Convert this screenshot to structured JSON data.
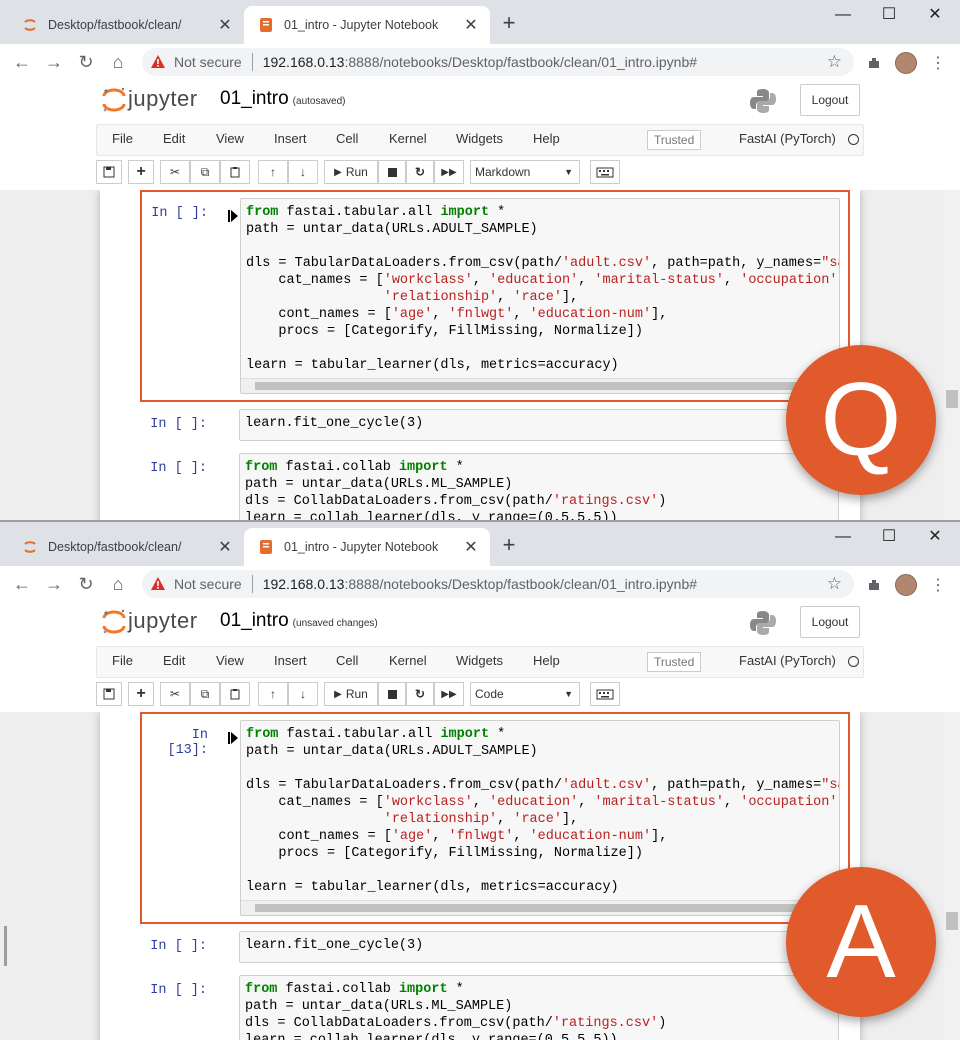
{
  "panels": [
    {
      "tabs": [
        {
          "title": "Desktop/fastbook/clean/"
        },
        {
          "title": "01_intro - Jupyter Notebook"
        }
      ],
      "address": {
        "security": "Not secure",
        "host": "192.168.0.13",
        "rest": ":8888/notebooks/Desktop/fastbook/clean/01_intro.ipynb#"
      },
      "jupyter": {
        "brand": "jupyter",
        "notebook_name": "01_intro",
        "save_status": "(autosaved)",
        "logout": "Logout"
      },
      "menu": [
        "File",
        "Edit",
        "View",
        "Insert",
        "Cell",
        "Kernel",
        "Widgets",
        "Help"
      ],
      "trusted": "Trusted",
      "kernel": "FastAI (PyTorch)",
      "toolbar": {
        "run_label": "Run",
        "cell_type": "Markdown"
      },
      "cells": [
        {
          "prompt": "In [ ]:"
        },
        {
          "prompt": "In [ ]:",
          "code": "learn.fit_one_cycle(3)"
        },
        {
          "prompt": "In [ ]:"
        }
      ],
      "badge": "Q"
    },
    {
      "tabs": [
        {
          "title": "Desktop/fastbook/clean/"
        },
        {
          "title": "01_intro - Jupyter Notebook"
        }
      ],
      "address": {
        "security": "Not secure",
        "host": "192.168.0.13",
        "rest": ":8888/notebooks/Desktop/fastbook/clean/01_intro.ipynb#"
      },
      "jupyter": {
        "brand": "jupyter",
        "notebook_name": "01_intro",
        "save_status": "(unsaved changes)",
        "logout": "Logout"
      },
      "menu": [
        "File",
        "Edit",
        "View",
        "Insert",
        "Cell",
        "Kernel",
        "Widgets",
        "Help"
      ],
      "trusted": "Trusted",
      "kernel": "FastAI (PyTorch)",
      "toolbar": {
        "run_label": "Run",
        "cell_type": "Code"
      },
      "cells": [
        {
          "prompt": "In [13]:"
        },
        {
          "prompt": "In [ ]:",
          "code": "learn.fit_one_cycle(3)"
        },
        {
          "prompt": "In [ ]:"
        }
      ],
      "badge": "A"
    }
  ],
  "code_cell_1": {
    "l1_kw1": "from",
    "l1_mod": " fastai.tabular.all ",
    "l1_kw2": "import",
    "l1_rest": " *",
    "l2": "path = untar_data(URLs.ADULT_SAMPLE)",
    "l4_a": "dls = TabularDataLoaders.from_csv(path/",
    "l4_s1": "'adult.csv'",
    "l4_b": ", path=path, y_names=",
    "l4_s2": "\"salar",
    "l5_a": "    cat_names = [",
    "l5_s1": "'workclass'",
    "l5_c1": ", ",
    "l5_s2": "'education'",
    "l5_c2": ", ",
    "l5_s3": "'marital-status'",
    "l5_c3": ", ",
    "l5_s4": "'occupation'",
    "l5_c4": ",",
    "l6_a": "                 ",
    "l6_s1": "'relationship'",
    "l6_c1": ", ",
    "l6_s2": "'race'",
    "l6_c2": "],",
    "l7_a": "    cont_names = [",
    "l7_s1": "'age'",
    "l7_c1": ", ",
    "l7_s2": "'fnlwgt'",
    "l7_c2": ", ",
    "l7_s3": "'education-num'",
    "l7_c3": "],",
    "l8": "    procs = [Categorify, FillMissing, Normalize])",
    "l10": "learn = tabular_learner(dls, metrics=accuracy)"
  },
  "code_cell_3": {
    "l1_kw1": "from",
    "l1_mod": " fastai.collab ",
    "l1_kw2": "import",
    "l1_rest": " *",
    "l2": "path = untar_data(URLs.ML_SAMPLE)",
    "l3_a": "dls = CollabDataLoaders.from_csv(path/",
    "l3_s1": "'ratings.csv'",
    "l3_b": ")",
    "l4": "learn = collab_learner(dls, y_range=(0.5,5.5))"
  }
}
